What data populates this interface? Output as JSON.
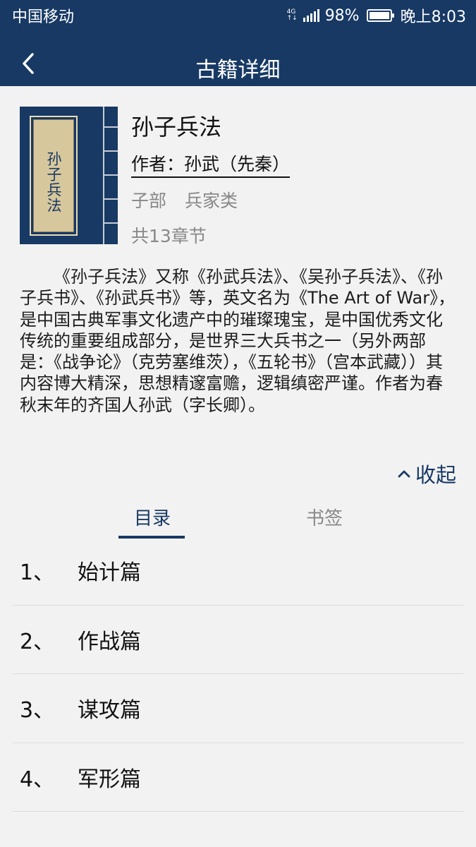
{
  "status_bar": {
    "carrier": "中国移动",
    "network_top": "4G",
    "network_bottom": "↑↓",
    "battery": "98%",
    "time": "晚上8:03"
  },
  "navbar": {
    "title": "古籍详细",
    "back_icon": "chevron-left-icon"
  },
  "book": {
    "cover_text": "孙子兵法",
    "title": "孙子兵法",
    "author": "作者：孙武（先秦）",
    "category": [
      "子部",
      "兵家类"
    ],
    "chapter_count": "共13章节",
    "description": "《孙子兵法》又称《孙武兵法》、《吴孙子兵法》、《孙子兵书》、《孙武兵书》等，英文名为《The Art of War》，是中国古典军事文化遗产中的璀璨瑰宝，是中国优秀文化传统的重要组成部分，是世界三大兵书之一（另外两部是：《战争论》（克劳塞维茨），《五轮书》（宫本武藏））其内容博大精深，思想精邃富赡，逻辑缜密严谨。作者为春秋末年的齐国人孙武（字长卿）。"
  },
  "collapse": {
    "label": "收起",
    "icon": "chevron-up-icon"
  },
  "tabs": {
    "catalog": "目录",
    "bookmark": "书签",
    "active": "catalog"
  },
  "chapters": [
    {
      "num": "1、",
      "name": "始计篇"
    },
    {
      "num": "2、",
      "name": "作战篇"
    },
    {
      "num": "3、",
      "name": "谋攻篇"
    },
    {
      "num": "4、",
      "name": "军形篇"
    }
  ],
  "colors": {
    "brand": "#173964",
    "background": "#f2f2f2",
    "muted_text": "#888888"
  }
}
